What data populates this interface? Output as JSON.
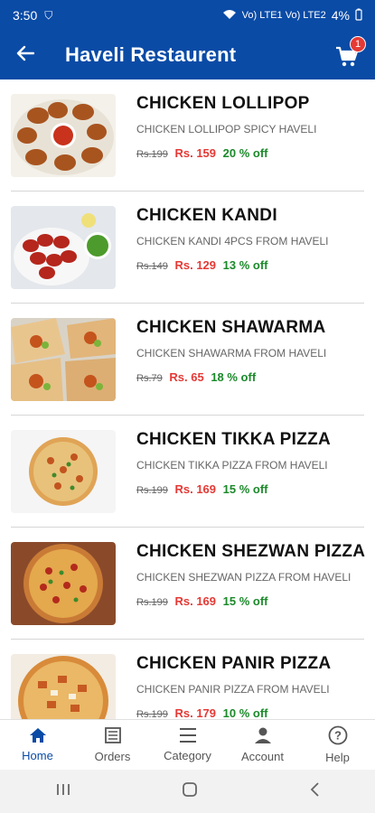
{
  "status": {
    "time": "3:50",
    "network": "Vo) LTE1 Vo) LTE2",
    "battery": "4%"
  },
  "header": {
    "title": "Haveli Restaurent",
    "cart_count": "1"
  },
  "items": [
    {
      "name": "CHICKEN LOLLIPOP",
      "desc": "CHICKEN LOLLIPOP SPICY HAVELI",
      "mrp": "Rs.199",
      "price": "Rs. 159",
      "off": "20 % off"
    },
    {
      "name": "CHICKEN KANDI",
      "desc": "CHICKEN KANDI 4PCS FROM HAVELI",
      "mrp": "Rs.149",
      "price": "Rs. 129",
      "off": "13 % off"
    },
    {
      "name": "CHICKEN SHAWARMA",
      "desc": "CHICKEN SHAWARMA FROM HAVELI",
      "mrp": "Rs.79",
      "price": "Rs. 65",
      "off": "18 % off"
    },
    {
      "name": "CHICKEN TIKKA PIZZA",
      "desc": "CHICKEN TIKKA PIZZA FROM HAVELI",
      "mrp": "Rs.199",
      "price": "Rs. 169",
      "off": "15 % off"
    },
    {
      "name": "CHICKEN SHEZWAN PIZZA",
      "desc": "CHICKEN SHEZWAN PIZZA FROM HAVELI",
      "mrp": "Rs.199",
      "price": "Rs. 169",
      "off": "15 % off"
    },
    {
      "name": "CHICKEN PANIR PIZZA",
      "desc": "CHICKEN PANIR PIZZA FROM HAVELI",
      "mrp": "Rs.199",
      "price": "Rs. 179",
      "off": "10 % off"
    }
  ],
  "bottom_nav": [
    {
      "label": "Home",
      "icon": "home-icon"
    },
    {
      "label": "Orders",
      "icon": "orders-icon"
    },
    {
      "label": "Category",
      "icon": "menu-icon"
    },
    {
      "label": "Account",
      "icon": "account-icon"
    },
    {
      "label": "Help",
      "icon": "help-icon"
    }
  ],
  "colors": {
    "primary": "#0a4ba6",
    "price": "#e53935",
    "discount": "#1b8a2a"
  }
}
